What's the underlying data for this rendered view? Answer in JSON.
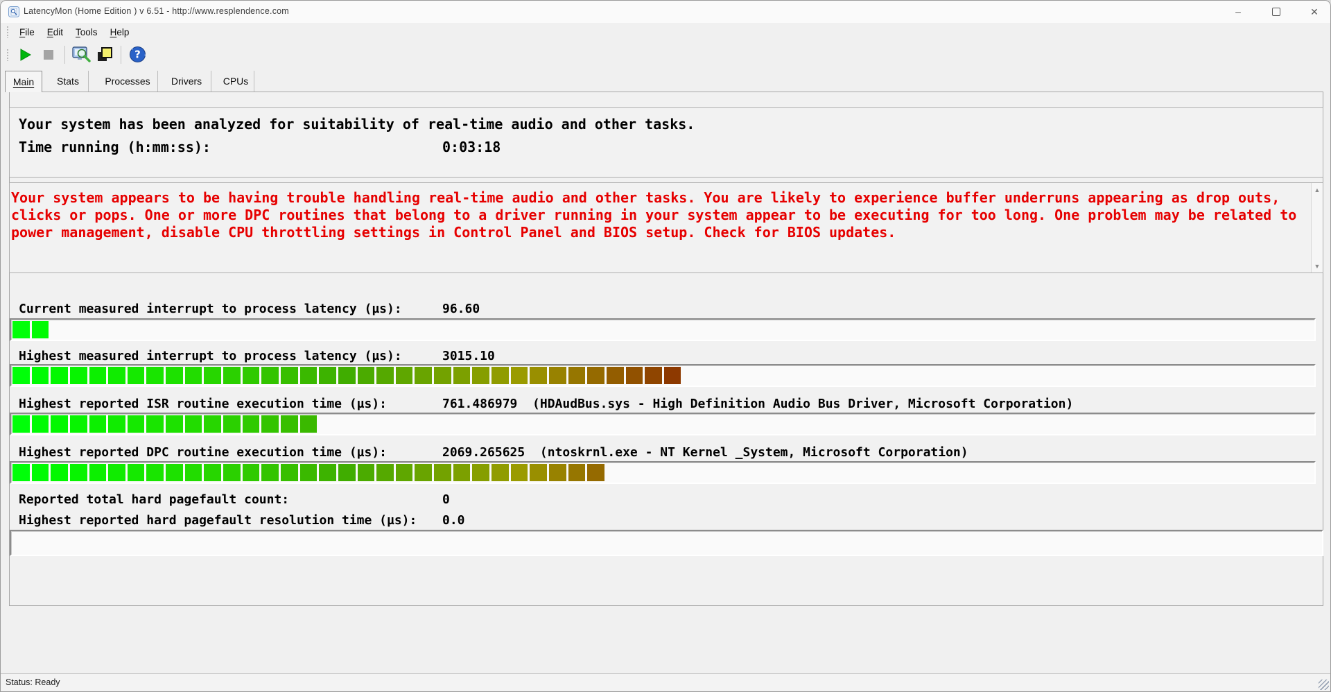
{
  "titlebar": {
    "title": "LatencyMon  (Home Edition )  v 6.51 - http://www.resplendence.com",
    "minimize_glyph": "–",
    "close_glyph": "✕"
  },
  "menubar": {
    "items": [
      "File",
      "Edit",
      "Tools",
      "Help"
    ]
  },
  "toolbar": {
    "buttons": [
      {
        "name": "start-button",
        "icon": "play-icon",
        "enabled": true
      },
      {
        "name": "stop-button",
        "icon": "stop-icon",
        "enabled": false
      },
      {
        "name": "analyze-button",
        "icon": "monitor-magnifier-icon",
        "enabled": true
      },
      {
        "name": "windows-button",
        "icon": "stacked-windows-icon",
        "enabled": true
      },
      {
        "name": "help-button",
        "icon": "help-question-icon",
        "enabled": true
      }
    ]
  },
  "tabs": [
    {
      "label": "Main",
      "active": true
    },
    {
      "label": "Stats",
      "active": false
    },
    {
      "label": "Processes",
      "active": false
    },
    {
      "label": "Drivers",
      "active": false
    },
    {
      "label": "CPUs",
      "active": false
    }
  ],
  "analysis": {
    "headline": "Your system has been analyzed for suitability of real-time audio and other tasks.",
    "time_label": "Time running (h:mm:ss):",
    "time_value": "0:03:18"
  },
  "warning": {
    "color": "#e60000",
    "lines": [
      "Your system appears to be having trouble handling real-time audio and other tasks. You are likely to experience buffer underruns appearing as drop outs,",
      "clicks or pops. One or more DPC routines that belong to a driver running in your system appear to be executing for too long. One problem may be related to",
      "power management, disable CPU throttling settings in Control Panel and BIOS setup. Check for BIOS updates."
    ]
  },
  "metrics": [
    {
      "label": "Current measured interrupt to process latency (µs):",
      "value": "96.60",
      "detail": "",
      "bar_segments": 2
    },
    {
      "label": "Highest measured interrupt to process latency (µs):",
      "value": "3015.10",
      "detail": "",
      "bar_segments": 35
    },
    {
      "label": "Highest reported ISR routine execution time (µs):",
      "value": "761.486979",
      "detail": "(HDAudBus.sys - High Definition Audio Bus Driver, Microsoft Corporation)",
      "bar_segments": 16
    },
    {
      "label": "Highest reported DPC routine execution time (µs):",
      "value": "2069.265625",
      "detail": "(ntoskrnl.exe - NT Kernel _System, Microsoft Corporation)",
      "bar_segments": 31
    },
    {
      "label": "Reported total hard pagefault count:",
      "value": "0",
      "detail": "",
      "bar_segments": null
    },
    {
      "label": "Highest reported hard pagefault resolution time (µs):",
      "value": "0.0",
      "detail": "",
      "bar_segments": null
    }
  ],
  "meter": {
    "total_slots": 68,
    "bright_green": "#00f50a",
    "end_red_brown": "#913f00"
  },
  "scrollbar": {
    "up_glyph": "▲",
    "down_glyph": "▼"
  },
  "statusbar": {
    "text": "Status: Ready"
  }
}
